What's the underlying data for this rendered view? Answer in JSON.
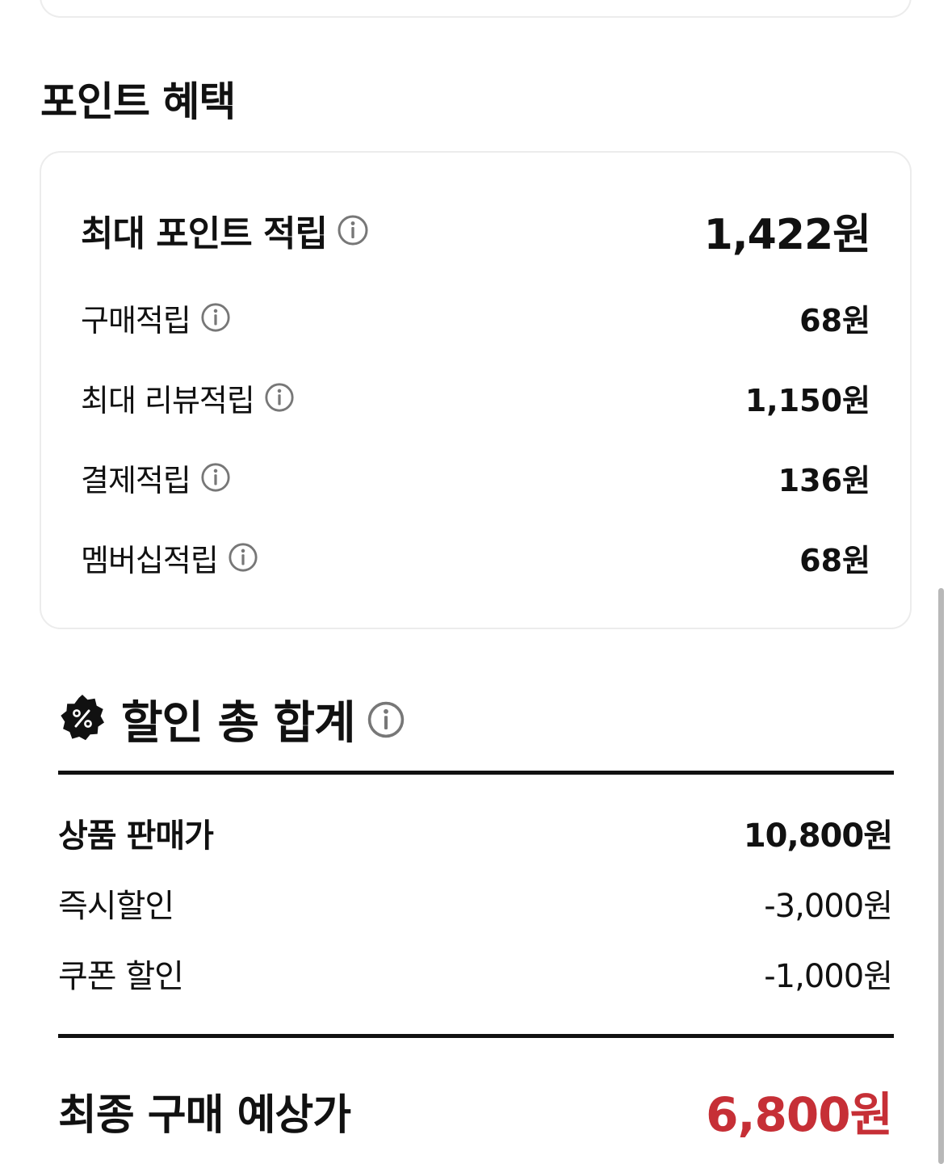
{
  "points_section": {
    "title": "포인트 혜택",
    "max_points": {
      "label": "최대 포인트 적립",
      "value": "1,422원"
    },
    "items": [
      {
        "label": "구매적립",
        "value": "68원"
      },
      {
        "label": "최대 리뷰적립",
        "value": "1,150원"
      },
      {
        "label": "결제적립",
        "value": "136원"
      },
      {
        "label": "멤버십적립",
        "value": "68원"
      }
    ]
  },
  "discount_section": {
    "title": "할인 총 합계",
    "badge_icon": "percent-badge-icon",
    "rows": [
      {
        "label": "상품 판매가",
        "value": "10,800원"
      },
      {
        "label": "즉시할인",
        "value": "-3,000원"
      },
      {
        "label": "쿠폰 할인",
        "value": "-1,000원"
      }
    ],
    "final": {
      "label": "최종 구매 예상가",
      "value": "6,800원"
    }
  },
  "colors": {
    "accent_red": "#c62f36",
    "text": "#111111",
    "card_border": "#ececec"
  },
  "icons": {
    "info": "info-circle-icon"
  }
}
